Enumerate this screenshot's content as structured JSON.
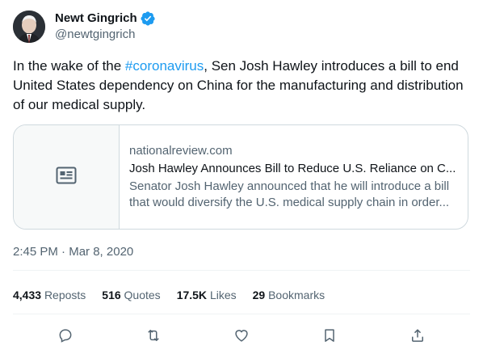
{
  "author": {
    "display_name": "Newt Gingrich",
    "handle": "@newtgingrich",
    "verified_icon": "verified-badge-icon"
  },
  "tweet": {
    "text_before": "In the wake of the ",
    "hashtag": "#coronavirus",
    "text_after": ", Sen Josh Hawley introduces a bill to end United States dependency on China for the manufacturing and distribution of our medical supply."
  },
  "link_card": {
    "domain": "nationalreview.com",
    "title": "Josh Hawley Announces Bill to Reduce U.S. Reliance on C...",
    "description": "Senator Josh Hawley announced that he will introduce a bill that would diversify the U.S. medical supply chain in order...",
    "thumb_icon": "article-icon"
  },
  "timestamp": {
    "time": "2:45 PM",
    "sep": " · ",
    "date": "Mar 8, 2020"
  },
  "stats": {
    "reposts_count": "4,433",
    "reposts_label": "Reposts",
    "quotes_count": "516",
    "quotes_label": "Quotes",
    "likes_count": "17.5K",
    "likes_label": "Likes",
    "bookmarks_count": "29",
    "bookmarks_label": "Bookmarks"
  },
  "actions": [
    "reply-icon",
    "repost-icon",
    "like-icon",
    "bookmark-icon",
    "share-icon"
  ],
  "colors": {
    "accent": "#1d9bf0",
    "text": "#0f1419",
    "secondary": "#536471",
    "border": "#cfd9de"
  }
}
